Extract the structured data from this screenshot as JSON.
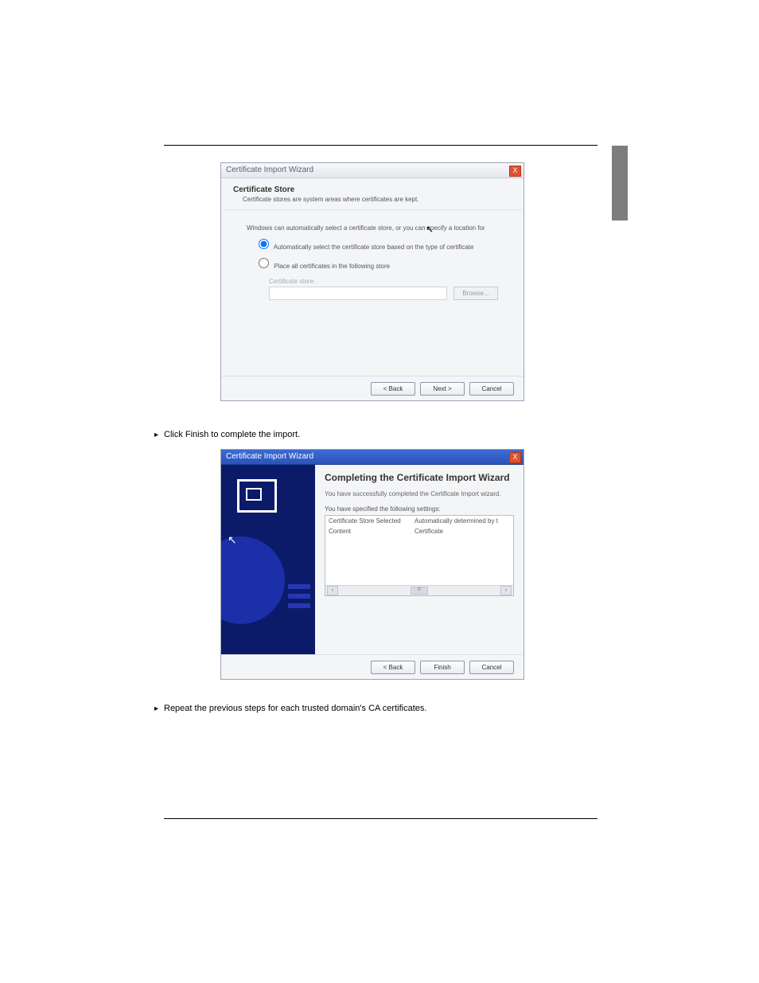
{
  "page": {
    "header_left": "",
    "header_right": "",
    "footer_left": "",
    "footer_right": ""
  },
  "steps": {
    "step2": "Click Finish to complete the import.",
    "step3": "Repeat the previous steps for each trusted domain's CA certificates."
  },
  "dlg1": {
    "title": "Certificate Import Wizard",
    "close": "X",
    "header_title": "Certificate Store",
    "header_sub": "Certificate stores are system areas where certificates are kept.",
    "body_intro": "Windows can automatically select a certificate store, or you can specify a location for",
    "radio_auto": "Automatically select the certificate store based on the type of certificate",
    "radio_manual": "Place all certificates in the following store",
    "store_label": "Certificate store:",
    "browse": "Browse...",
    "back": "< Back",
    "next": "Next >",
    "cancel": "Cancel"
  },
  "dlg2": {
    "title": "Certificate Import Wizard",
    "close": "X",
    "heading": "Completing the Certificate Import Wizard",
    "para1": "You have successfully completed the Certificate Import wizard.",
    "para2": "You have specified the following settings:",
    "rows": [
      {
        "c1": "Certificate Store Selected",
        "c2": "Automatically determined by t"
      },
      {
        "c1": "Content",
        "c2": "Certificate"
      }
    ],
    "scroll_thumb": "III",
    "back": "< Back",
    "finish": "Finish",
    "cancel": "Cancel"
  }
}
